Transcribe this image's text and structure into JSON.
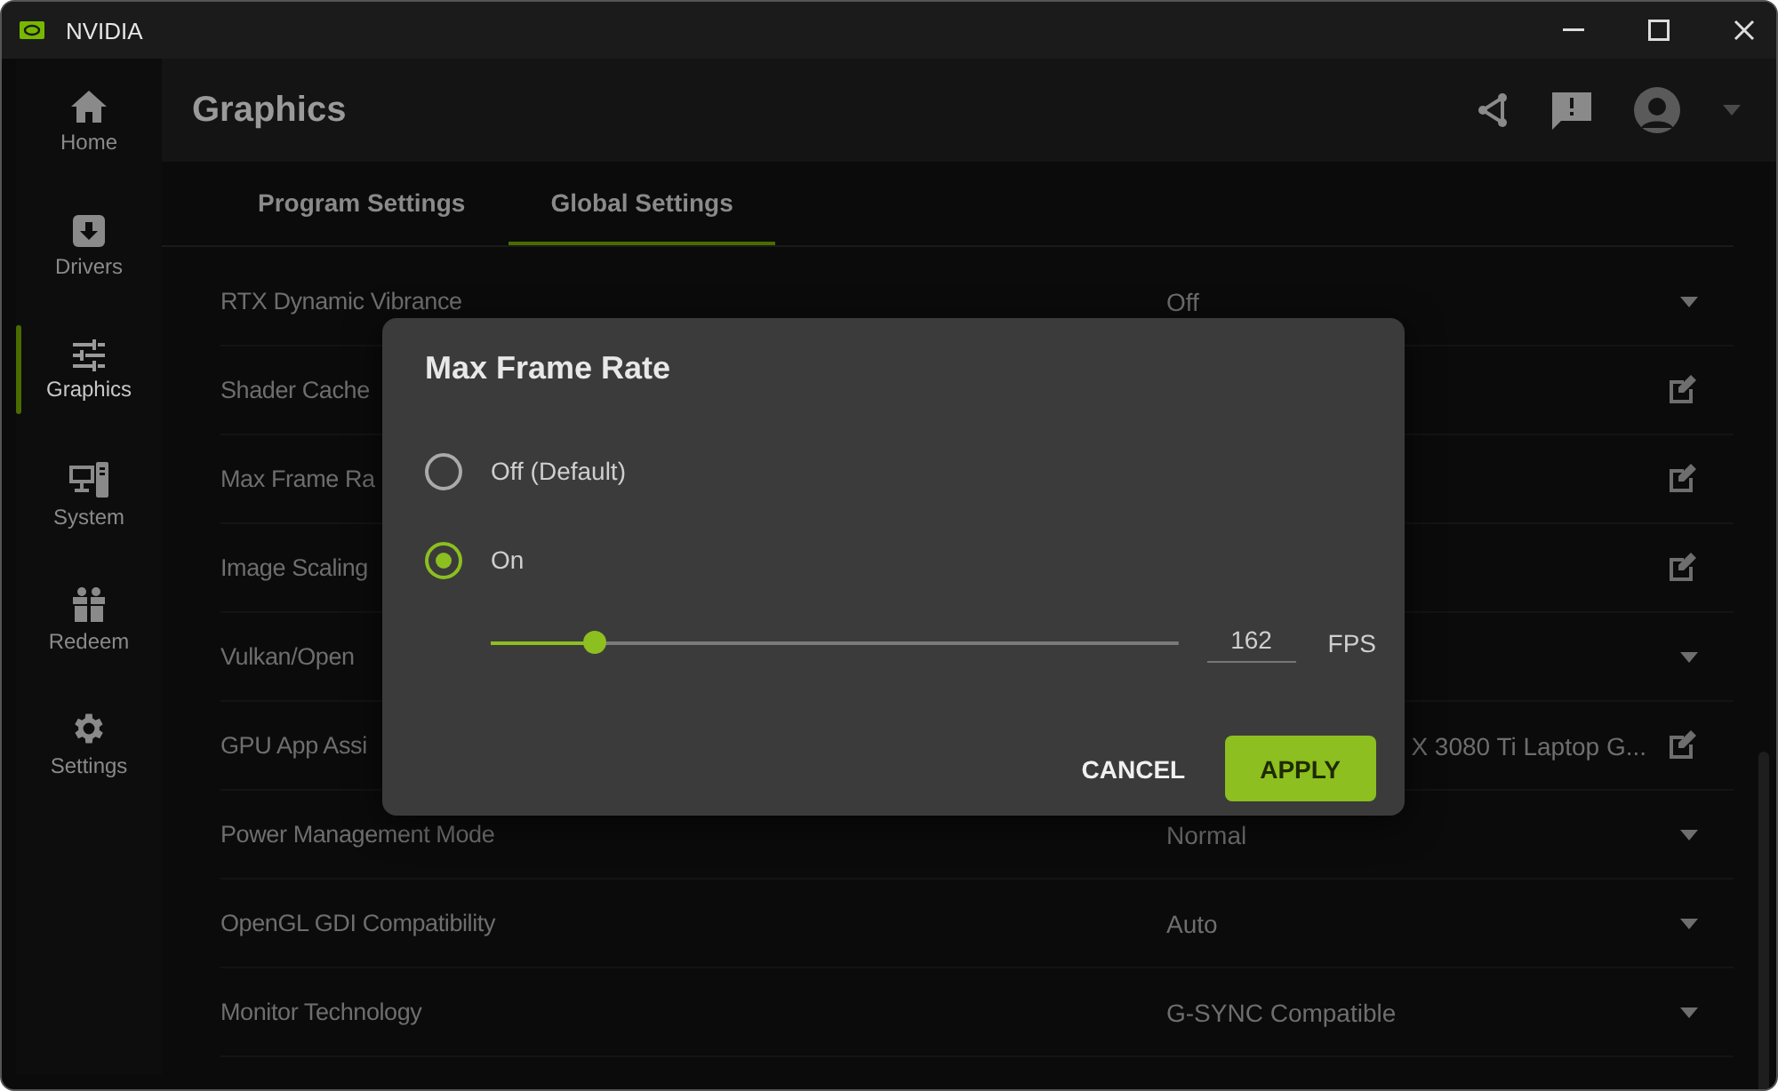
{
  "window": {
    "title": "NVIDIA"
  },
  "sidebar": {
    "items": [
      {
        "label": "Home",
        "selected": false
      },
      {
        "label": "Drivers",
        "selected": false
      },
      {
        "label": "Graphics",
        "selected": true
      },
      {
        "label": "System",
        "selected": false
      },
      {
        "label": "Redeem",
        "selected": false
      },
      {
        "label": "Settings",
        "selected": false
      }
    ]
  },
  "header": {
    "title": "Graphics"
  },
  "tabs": [
    {
      "label": "Program Settings",
      "selected": false
    },
    {
      "label": "Global Settings",
      "selected": true
    }
  ],
  "settings": [
    {
      "label": "RTX Dynamic Vibrance",
      "value": "Off",
      "kind": "dropdown"
    },
    {
      "label": "Shader Cache",
      "kind": "edit"
    },
    {
      "label": "Max Frame Ra",
      "kind": "edit"
    },
    {
      "label": "Image Scaling",
      "kind": "edit"
    },
    {
      "label": "Vulkan/Open",
      "kind": "dropdown"
    },
    {
      "label": "GPU App Assi",
      "value": "X 3080 Ti Laptop G...",
      "kind": "edit"
    },
    {
      "label": "Power Management Mode",
      "value": "Normal",
      "kind": "dropdown"
    },
    {
      "label": "OpenGL GDI Compatibility",
      "value": "Auto",
      "kind": "dropdown"
    },
    {
      "label": "Monitor Technology",
      "value": "G-SYNC Compatible",
      "kind": "dropdown"
    }
  ],
  "dialog": {
    "title": "Max Frame Rate",
    "options": [
      {
        "label": "Off (Default)",
        "selected": false
      },
      {
        "label": "On",
        "selected": true
      }
    ],
    "slider": {
      "level": 0.15,
      "value": "162",
      "unit": "FPS"
    },
    "buttons": [
      {
        "label": "CANCEL",
        "kind": "text"
      },
      {
        "label": "APPLY",
        "kind": "primary"
      }
    ]
  }
}
